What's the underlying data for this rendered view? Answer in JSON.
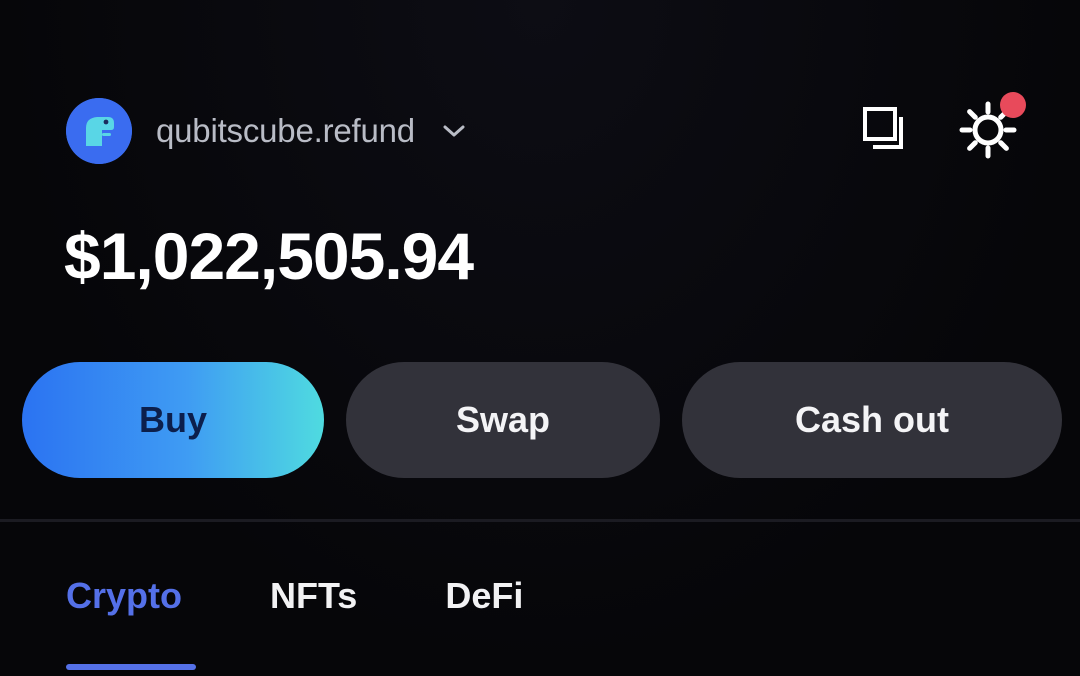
{
  "header": {
    "account_name": "qubitscube.refund",
    "avatar_icon": "dino-avatar-icon",
    "chevron_icon": "chevron-down-icon",
    "copy_icon": "copy-icon",
    "settings_icon": "gear-icon",
    "has_notification": true
  },
  "balance": {
    "amount": "$1,022,505.94"
  },
  "actions": {
    "buy_label": "Buy",
    "swap_label": "Swap",
    "cashout_label": "Cash out"
  },
  "tabs": [
    {
      "label": "Crypto",
      "active": true
    },
    {
      "label": "NFTs",
      "active": false
    },
    {
      "label": "DeFi",
      "active": false
    }
  ],
  "colors": {
    "background": "#07070b",
    "accent": "#5470e8",
    "buy_gradient_start": "#2b73f2",
    "buy_gradient_end": "#4fdbe0",
    "secondary_button": "#32323a",
    "notification": "#e84a5b"
  }
}
